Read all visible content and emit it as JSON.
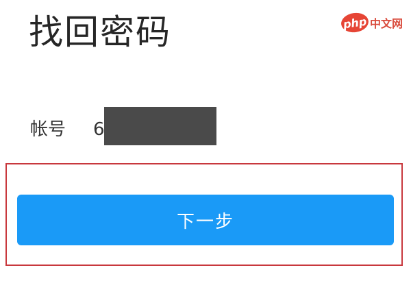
{
  "watermark": {
    "logo_text": "php",
    "site_text": "中文网",
    "logo_color": "#e64535"
  },
  "page": {
    "title": "找回密码"
  },
  "account": {
    "label": "帐号",
    "value_visible": "6",
    "masked": true
  },
  "actions": {
    "next_label": "下一步",
    "button_color": "#1a9af7",
    "highlight_color": "#c8383d"
  }
}
